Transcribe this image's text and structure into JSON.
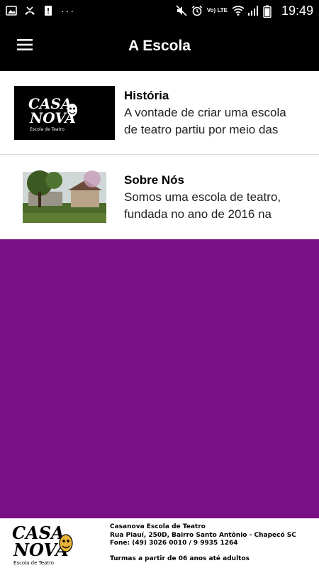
{
  "status_bar": {
    "time": "19:49",
    "network": "Vo) LTE",
    "left_icons": [
      "image-icon",
      "missed-call-icon",
      "alert-icon"
    ],
    "right_icons": [
      "mute-icon",
      "alarm-icon",
      "wifi-icon",
      "signal-icon",
      "battery-icon"
    ]
  },
  "app_bar": {
    "title": "A Escola",
    "menu_icon": "hamburger-menu-icon"
  },
  "list": {
    "items": [
      {
        "title": "História",
        "desc_line1": "A vontade de criar uma escola",
        "desc_line2": "de teatro partiu por meio das",
        "thumb_logo_top": "CASA",
        "thumb_logo_bottom": "NOVA",
        "thumb_caption": "Escola de Teatro"
      },
      {
        "title": "Sobre Nós",
        "desc_line1": "Somos uma escola de teatro,",
        "desc_line2": "fundada no ano de 2016 na"
      }
    ]
  },
  "footer": {
    "logo_top": "CASA",
    "logo_bottom": "NOVA",
    "logo_caption": "Escola de Teatro",
    "line1": "Casanova Escola de Teatro",
    "line2": "Rua Piauí, 250D, Bairro Santo Antônio - Chapecó SC",
    "line3": "Fone: (49) 3026 0010 / 9 9935 1264",
    "line4": "Turmas a partir de 06 anos até adultos"
  },
  "colors": {
    "bar_background": "#000000",
    "content_background": "#7a0f86",
    "list_background": "#ffffff"
  }
}
